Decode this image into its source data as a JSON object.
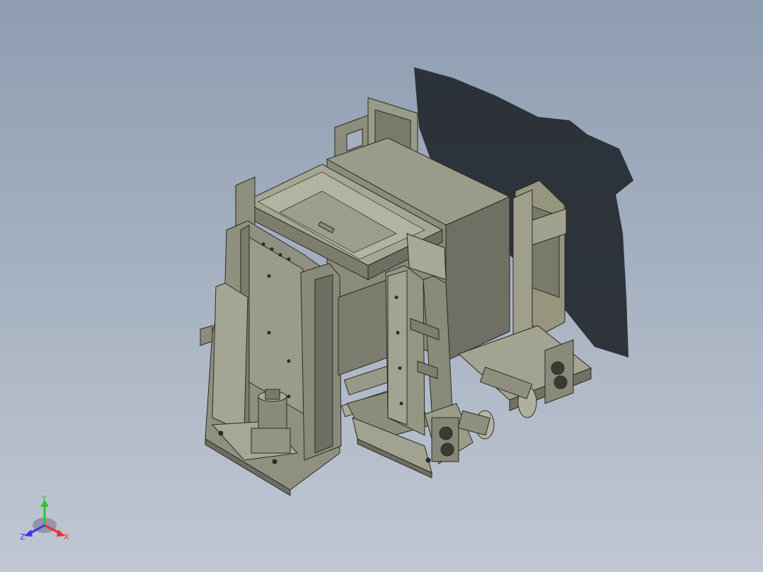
{
  "viewport": {
    "background_top": "#8f9db1",
    "background_bottom": "#c1c7d3",
    "model_fill": "#9a9a88",
    "model_dark": "#6d6d62",
    "model_edge": "#2a2a26",
    "shadow": "#1e2228"
  },
  "triad": {
    "x_label": "X",
    "y_label": "Y",
    "z_label": "Z",
    "x_color": "#e53030",
    "y_color": "#2fc238",
    "z_color": "#3a3ae0"
  }
}
